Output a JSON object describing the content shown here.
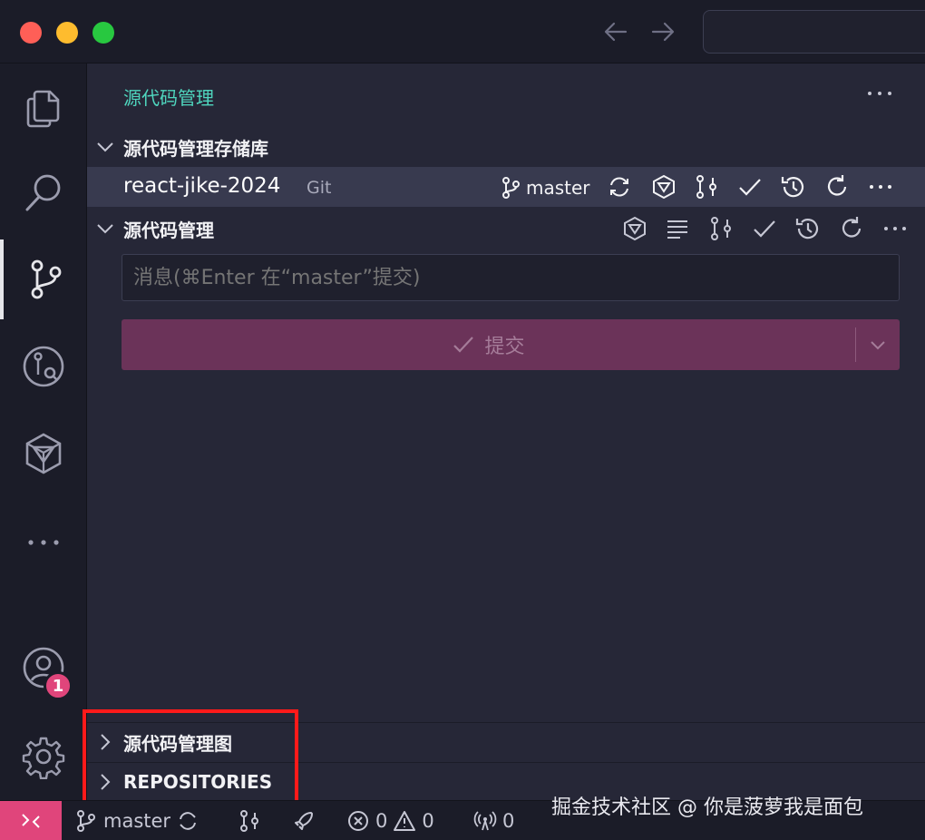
{
  "titlebar": {
    "back_icon": "arrow-left-icon",
    "forward_icon": "arrow-right-icon"
  },
  "activity_bar": {
    "items": [
      "explorer-icon",
      "search-icon",
      "source-control-icon",
      "git-graph-icon",
      "tongyi-icon",
      "more-icon"
    ],
    "accounts_badge": "1"
  },
  "sidebar": {
    "title": "源代码管理",
    "repos_section": "源代码管理存储库",
    "repo": {
      "name": "react-jike-2024",
      "type": "Git",
      "branch": "master"
    },
    "changes_section": "源代码管理",
    "message_placeholder": "消息(⌘Enter 在“master”提交)",
    "commit_label": "提交",
    "graph_section": "源代码管理图",
    "repositories_section": "REPOSITORIES"
  },
  "statusbar": {
    "branch": "master",
    "errors": "0",
    "warnings": "0",
    "ports": "0",
    "accent_color": "#e0457b"
  },
  "watermark": "掘金技术社区 @ 你是菠萝我是面包",
  "colors": {
    "title_accent": "#4fd6be",
    "commit_bg": "#6b3359",
    "highlight": "#ff1a1a"
  }
}
